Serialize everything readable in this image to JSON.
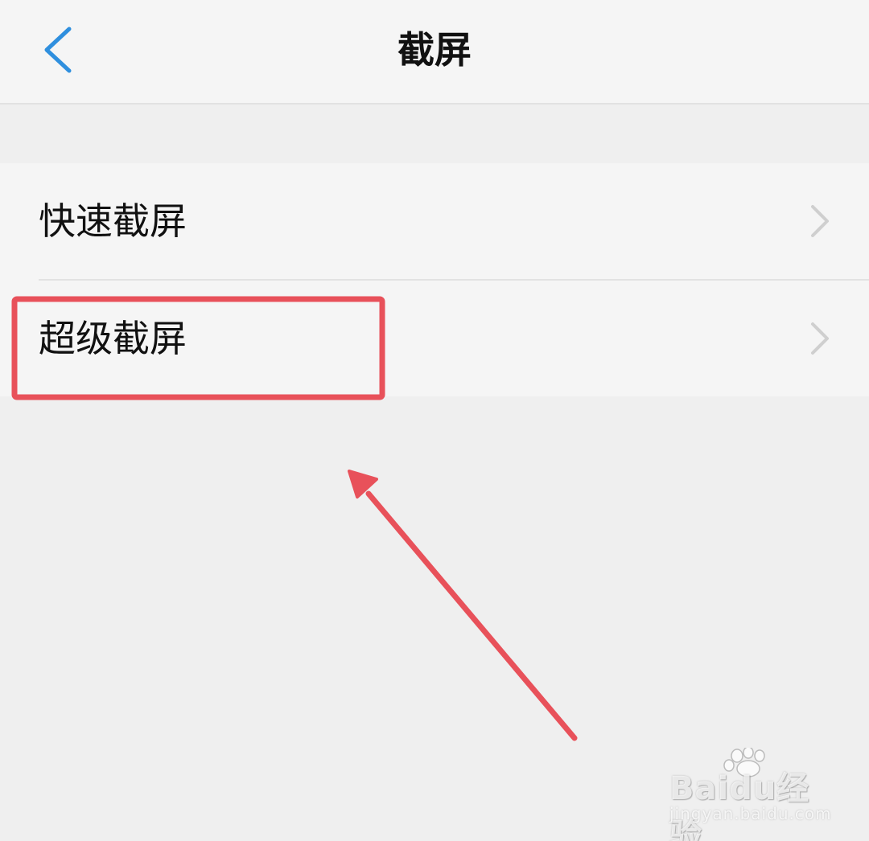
{
  "header": {
    "title": "截屏",
    "back_icon": "chevron-left-icon"
  },
  "settings_list": {
    "items": [
      {
        "label": "快速截屏",
        "icon": "chevron-right-icon"
      },
      {
        "label": "超级截屏",
        "icon": "chevron-right-icon"
      }
    ]
  },
  "annotation": {
    "color": "#e8515a"
  },
  "watermark": {
    "brand": "Baidu经验",
    "url": "jingyan.baidu.com"
  },
  "colors": {
    "accent": "#2f8fde",
    "background": "#efefef",
    "surface": "#f5f5f5"
  }
}
